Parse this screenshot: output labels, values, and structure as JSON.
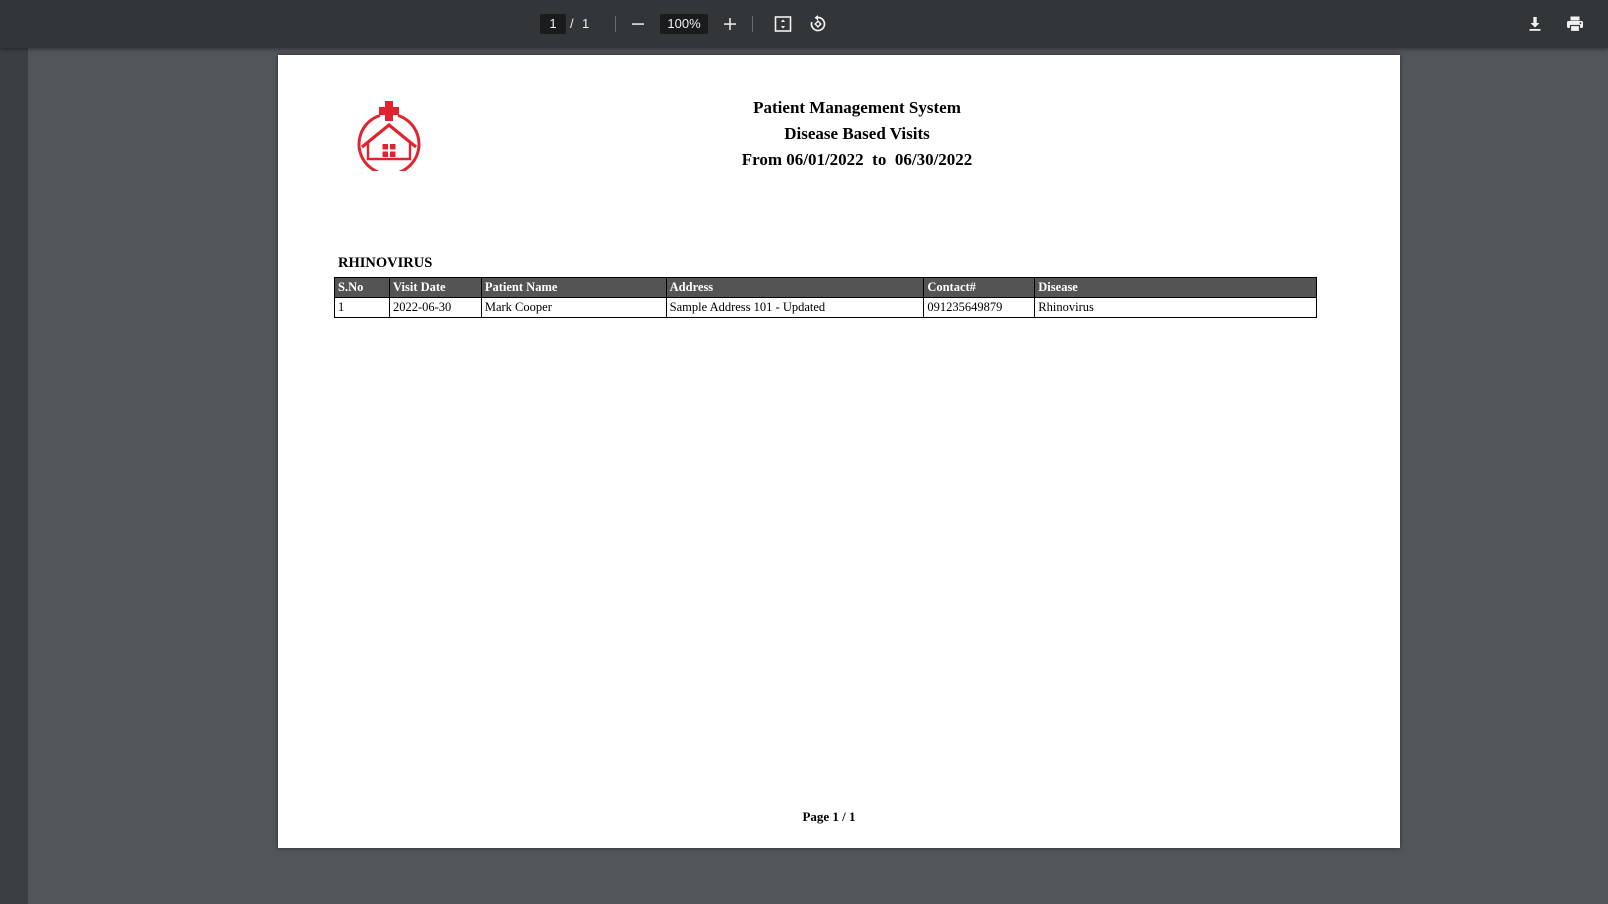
{
  "toolbar": {
    "current_page": "1",
    "page_separator": "/",
    "total_pages": "1",
    "zoom_level": "100%",
    "icons": {
      "zoom_out": "minus-icon",
      "zoom_in": "plus-icon",
      "fit": "fit-to-page-icon",
      "rotate": "rotate-icon",
      "download": "download-icon",
      "print": "print-icon"
    }
  },
  "document": {
    "logo": {
      "icon": "medical-home-logo",
      "color": "#e0242f"
    },
    "title_lines": [
      "Patient Management System",
      "Disease Based Visits",
      "From 06/01/2022  to  06/30/2022"
    ],
    "section_title": "RHINOVIRUS",
    "table": {
      "columns": [
        "S.No",
        "Visit Date",
        "Patient Name",
        "Address",
        "Contact#",
        "Disease"
      ],
      "rows": [
        [
          "1",
          "2022-06-30",
          "Mark Cooper",
          "Sample Address 101 - Updated",
          "091235649879",
          "Rhinovirus"
        ]
      ]
    },
    "footer": "Page 1 / 1"
  }
}
